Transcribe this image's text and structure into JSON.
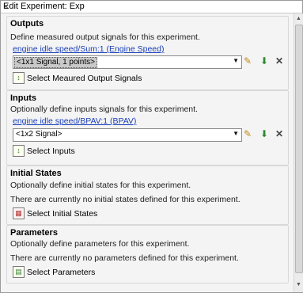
{
  "window": {
    "title": "Edit Experiment: Exp"
  },
  "outputs": {
    "title": "Outputs",
    "description": "Define measured output signals for this experiment.",
    "signal_link": "engine idle speed/Sum:1 (Engine Speed)",
    "dropdown_value": "<1x1 Signal, 1 points>",
    "action_label": "Select Meaured Output Signals"
  },
  "inputs": {
    "title": "Inputs",
    "description": "Optionally define inputs signals for this experiment.",
    "signal_link": "engine idle speed/BPAV:1 (BPAV)",
    "dropdown_value": "<1x2 Signal>",
    "action_label": "Select Inputs"
  },
  "initial_states": {
    "title": "Initial States",
    "description": "Optionally define initial states for this experiment.",
    "status": "There are currently no initial states defined for this experiment.",
    "action_label": "Select Initial States"
  },
  "parameters": {
    "title": "Parameters",
    "description": "Optionally define parameters for this experiment.",
    "status": "There are currently no parameters defined for this experiment.",
    "action_label": "Select Parameters"
  },
  "icons": {
    "edit": "edit-signal-icon",
    "import": "import-icon",
    "delete": "delete-icon"
  },
  "colors": {
    "link": "#1a3fb8",
    "panel_bg": "#f4f4f4"
  }
}
